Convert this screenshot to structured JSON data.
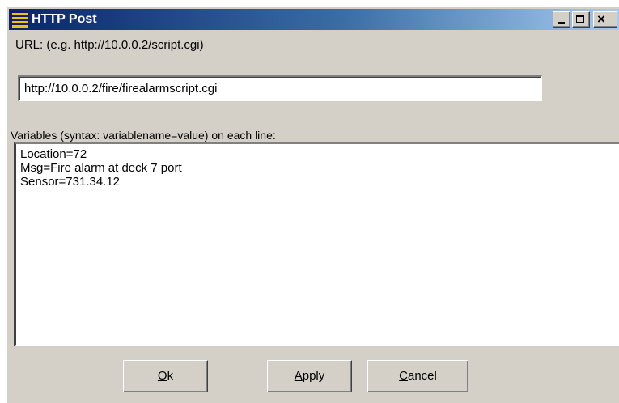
{
  "window": {
    "title": "HTTP Post",
    "controls": {
      "minimize_icon": "minimize-icon",
      "maximize_icon": "maximize-icon",
      "close_icon": "close-icon"
    }
  },
  "url": {
    "label": "URL: (e.g. http://10.0.0.2/script.cgi)",
    "value": "http://10.0.0.2/fire/firealarmscript.cgi"
  },
  "variables": {
    "label": "Variables (syntax: variablename=value) on each line:",
    "lines": [
      "Location=72",
      "Msg=Fire alarm at deck 7 port",
      "Sensor=731.34.12"
    ]
  },
  "buttons": {
    "ok": {
      "accel": "O",
      "rest": "k"
    },
    "apply": {
      "accel": "A",
      "rest": "pply"
    },
    "cancel": {
      "accel": "C",
      "rest": "ancel"
    }
  },
  "colors": {
    "face": "#d4d0c8",
    "titlebar_start": "#0a246a",
    "titlebar_end": "#a6caf0"
  }
}
